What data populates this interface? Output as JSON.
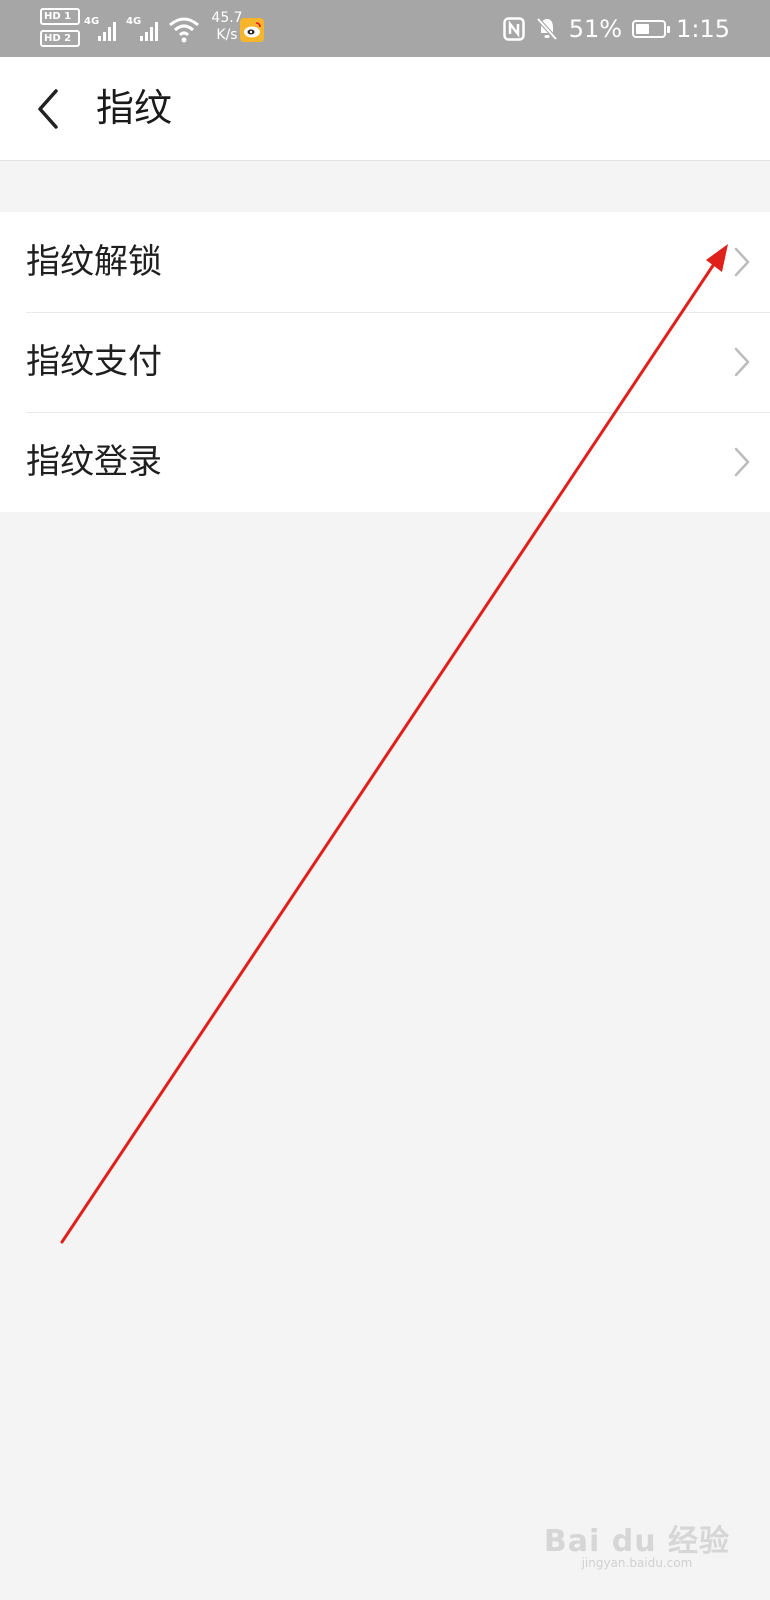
{
  "status_bar": {
    "sim1": "HD 1",
    "sim2": "HD 2",
    "network1": "4G",
    "network2": "4G",
    "net_speed_value": "45.7",
    "net_speed_unit": "K/s",
    "battery_percent_text": "51%",
    "battery_level": 0.51,
    "time": "1:15"
  },
  "header": {
    "title": "指纹"
  },
  "menu": {
    "items": [
      {
        "label": "指纹解锁"
      },
      {
        "label": "指纹支付"
      },
      {
        "label": "指纹登录"
      }
    ]
  },
  "annotation": {
    "color": "#e0201b"
  },
  "watermark": {
    "brand": "Bai du 经验",
    "url": "jingyan.baidu.com"
  }
}
